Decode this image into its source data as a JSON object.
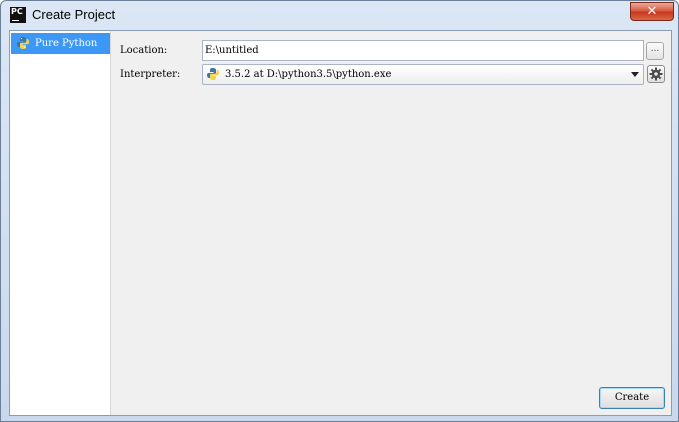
{
  "window": {
    "title": "Create Project",
    "app_icon_text": "PC",
    "close_glyph": "✕"
  },
  "sidebar": {
    "items": [
      {
        "label": "Pure Python",
        "icon": "python-icon",
        "selected": true
      }
    ]
  },
  "form": {
    "location_label": "Location:",
    "location_value": "E:\\untitled",
    "browse_label": "...",
    "interpreter_label": "Interpreter:",
    "interpreter_value": "3.5.2 at D:\\python3.5\\python.exe",
    "interpreter_icon": "python-icon",
    "settings_icon": "gear-icon"
  },
  "footer": {
    "create_label": "Create"
  },
  "colors": {
    "selection": "#3d98f5",
    "close_button": "#c8351a",
    "panel_background": "#f0f0f0"
  }
}
